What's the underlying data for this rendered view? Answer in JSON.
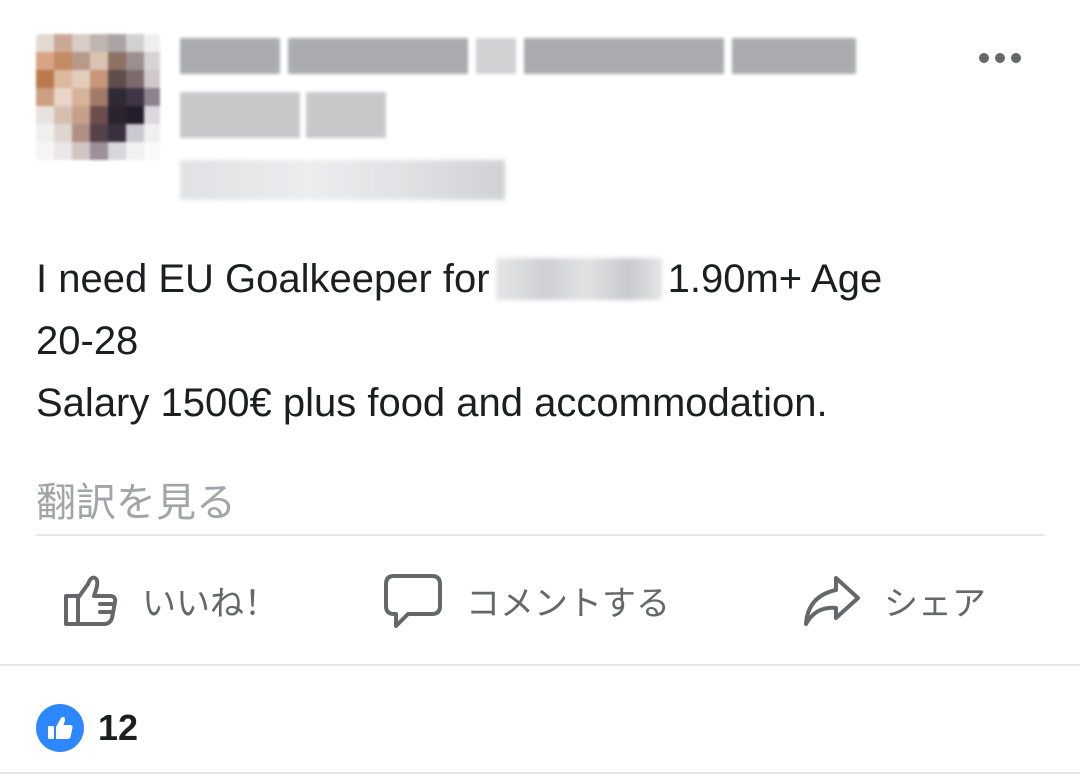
{
  "post": {
    "text_line1_before": "I need EU Goalkeeper for",
    "text_line1_after": "1.90m+ Age",
    "text_line2": "20-28",
    "text_line3": "Salary 1500€ plus food and accommodation.",
    "see_translation": "翻訳を見る"
  },
  "actions": {
    "like": "いいね！",
    "comment": "コメントする",
    "share": "シェア"
  },
  "reactions": {
    "count": "12"
  },
  "colors": {
    "secondary_text": "#65676b",
    "like_badge": "#2d88ff",
    "divider": "#e4e6ea"
  },
  "icons": {
    "more": "more-horizontal-icon",
    "like": "thumbs-up-outline-icon",
    "comment": "speech-bubble-icon",
    "share": "share-arrow-icon",
    "reaction": "like-reaction-icon"
  }
}
